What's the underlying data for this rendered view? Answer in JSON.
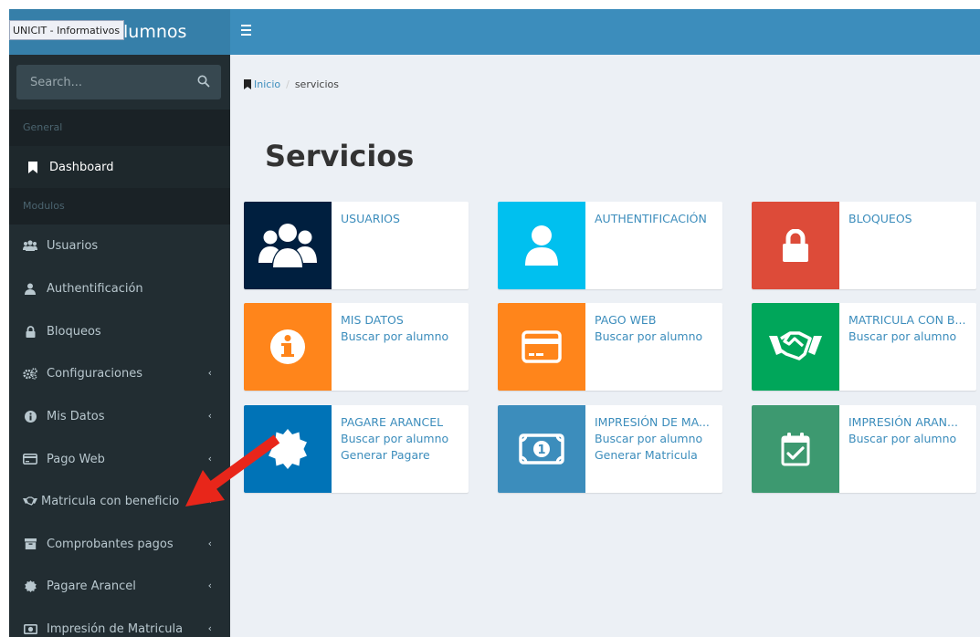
{
  "header": {
    "tag": "UNICIT - Informativos",
    "title_suffix": "lumnos"
  },
  "search": {
    "placeholder": "Search..."
  },
  "sidebar": {
    "section_general": "General",
    "section_modulos": "Modulos",
    "items": [
      {
        "label": "Dashboard",
        "icon": "bookmark-icon"
      },
      {
        "label": "Usuarios",
        "icon": "users-icon"
      },
      {
        "label": "Authentificación",
        "icon": "user-icon"
      },
      {
        "label": "Bloqueos",
        "icon": "lock-icon"
      },
      {
        "label": "Configuraciones",
        "icon": "gears-icon"
      },
      {
        "label": "Mis Datos",
        "icon": "info-icon"
      },
      {
        "label": "Pago Web",
        "icon": "credit-card-icon"
      },
      {
        "label": "Matricula con beneficio",
        "icon": "handshake-icon"
      },
      {
        "label": "Comprobantes pagos",
        "icon": "archive-icon"
      },
      {
        "label": "Pagare Arancel",
        "icon": "certificate-icon"
      },
      {
        "label": "Impresión de Matricula",
        "icon": "money-icon"
      }
    ]
  },
  "breadcrumb": {
    "home": "Inicio",
    "current": "servicios"
  },
  "page": {
    "title": "Servicios"
  },
  "boxes": [
    {
      "title": "USUARIOS",
      "links": [],
      "color": "#001f3f",
      "icon": "users-icon"
    },
    {
      "title": "AUTHENTIFICACIÓN",
      "links": [],
      "color": "#00c0ef",
      "icon": "user-icon"
    },
    {
      "title": "BLOQUEOS",
      "links": [],
      "color": "#dd4b39",
      "icon": "lock-icon"
    },
    {
      "title": "MIS DATOS",
      "links": [
        "Buscar por alumno"
      ],
      "color": "#ff851b",
      "icon": "info-icon"
    },
    {
      "title": "PAGO WEB",
      "links": [
        "Buscar por alumno"
      ],
      "color": "#ff851b",
      "icon": "credit-card-icon"
    },
    {
      "title": "MATRICULA CON B...",
      "links": [
        "Buscar por alumno"
      ],
      "color": "#00a65a",
      "icon": "handshake-icon"
    },
    {
      "title": "PAGARE ARANCEL",
      "links": [
        "Buscar por alumno",
        "Generar Pagare"
      ],
      "color": "#0073b7",
      "icon": "certificate-icon"
    },
    {
      "title": "IMPRESIÓN DE MA...",
      "links": [
        "Buscar por alumno",
        "Generar Matricula"
      ],
      "color": "#3c8dbc",
      "icon": "money-icon"
    },
    {
      "title": "IMPRESIÓN ARAN...",
      "links": [
        "Buscar por alumno"
      ],
      "color": "#3d9970",
      "icon": "calendar-check-icon"
    }
  ],
  "colors": {
    "topbar": "#3c8dbc",
    "sidebar": "#222d32",
    "annotation_arrow": "#e8261a"
  }
}
